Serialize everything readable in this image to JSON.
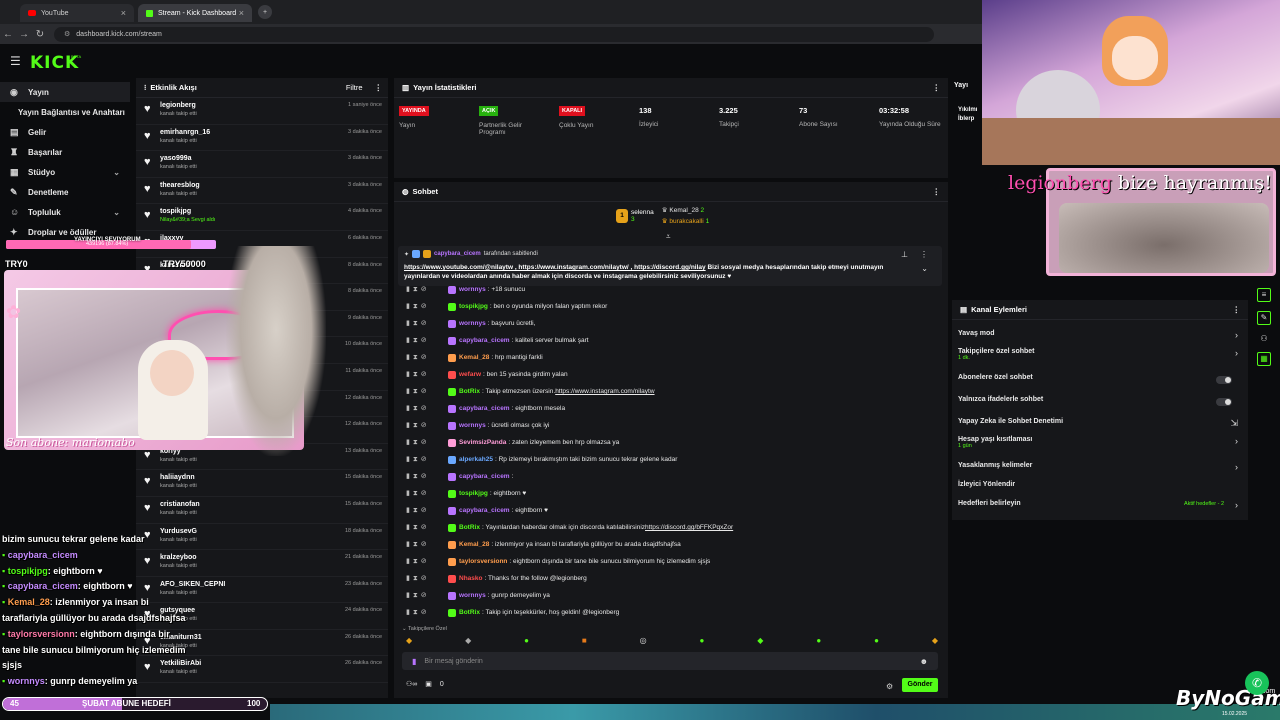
{
  "browser": {
    "tabs": [
      {
        "label": "YouTube"
      },
      {
        "label": "Stream - Kick Dashboard"
      }
    ],
    "url": "dashboard.kick.com/stream"
  },
  "kick": {
    "logo": "KICK",
    "logo_sup": "BETA"
  },
  "sidebar": {
    "items": [
      {
        "label": "Yayın",
        "icon": "broadcast-icon"
      },
      {
        "label": "Yayın Bağlantısı ve Anahtarı",
        "icon": ""
      },
      {
        "label": "Gelir",
        "icon": "wallet-icon"
      },
      {
        "label": "Başarılar",
        "icon": "trophy-icon"
      },
      {
        "label": "Stüdyo",
        "icon": "studio-icon"
      },
      {
        "label": "Denetleme",
        "icon": "wrench-icon"
      },
      {
        "label": "Topluluk",
        "icon": "community-icon"
      },
      {
        "label": "Droplar ve ödüller",
        "icon": "gift-icon"
      }
    ]
  },
  "activity": {
    "title": "Etkinlik Akışı",
    "filter": "Filtre",
    "items": [
      {
        "name": "legionberg",
        "sub": "kanalı takip etti",
        "time": "1 saniye önce"
      },
      {
        "name": "emirhanrgn_16",
        "sub": "kanalı takip etti",
        "time": "3 dakika önce"
      },
      {
        "name": "yaso999a",
        "sub": "kanalı takip etti",
        "time": "3 dakika önce"
      },
      {
        "name": "thearesblog",
        "sub": "kanalı takip etti",
        "time": "3 dakika önce"
      },
      {
        "name": "tospikjpg",
        "sub": "Nilay&#39;a Sevgi aldı",
        "time": "4 dakika önce"
      },
      {
        "name": "ilaxxyy",
        "sub": "",
        "time": "6 dakika önce"
      },
      {
        "name": "kakashisi",
        "sub": "",
        "time": "8 dakika önce"
      },
      {
        "name": "",
        "sub": "",
        "time": "8 dakika önce"
      },
      {
        "name": "",
        "sub": "",
        "time": "9 dakika önce"
      },
      {
        "name": "",
        "sub": "",
        "time": "10 dakika önce"
      },
      {
        "name": "",
        "sub": "",
        "time": "11 dakika önce"
      },
      {
        "name": "",
        "sub": "",
        "time": "12 dakika önce"
      },
      {
        "name": "",
        "sub": "",
        "time": "12 dakika önce"
      },
      {
        "name": "korlyy",
        "sub": "kanalı takip etti",
        "time": "13 dakika önce"
      },
      {
        "name": "haliiaydnn",
        "sub": "kanalı takip etti",
        "time": "15 dakika önce"
      },
      {
        "name": "cristianofan",
        "sub": "kanalı takip etti",
        "time": "15 dakika önce"
      },
      {
        "name": "YurdusevG",
        "sub": "kanalı takip etti",
        "time": "18 dakika önce"
      },
      {
        "name": "kralzeyboo",
        "sub": "kanalı takip etti",
        "time": "21 dakika önce"
      },
      {
        "name": "AFO_SIKEN_CEPNI",
        "sub": "kanalı takip etti",
        "time": "23 dakika önce"
      },
      {
        "name": "gutsyquee",
        "sub": "kanalı takip etti",
        "time": "24 dakika önce"
      },
      {
        "name": "emaniturn31",
        "sub": "kanalı takip etti",
        "time": "26 dakika önce"
      },
      {
        "name": "YetkiliBirAbi",
        "sub": "kanalı takip etti",
        "time": "26 dakika önce"
      }
    ]
  },
  "stats": {
    "title": "Yayın İstatistikleri",
    "items": [
      {
        "badge": "YAYINDA",
        "badge_color": "#e0101e",
        "label": "Yayın"
      },
      {
        "badge": "AÇIK",
        "badge_color": "#27b10e",
        "label": "Partnerlik Gelir Programı"
      },
      {
        "badge": "KAPALI",
        "badge_color": "#e0101e",
        "label": "Çoklu Yayın"
      },
      {
        "value": "138",
        "label": "İzleyici"
      },
      {
        "value": "3.225",
        "label": "Takipçi"
      },
      {
        "value": "73",
        "label": "Abone Sayısı"
      },
      {
        "value": "03:32:58",
        "label": "Yayında Olduğu Süre"
      }
    ]
  },
  "chat": {
    "title": "Sohbet",
    "top_gifters": [
      {
        "rank": "1",
        "name": "selenna",
        "count": "3"
      },
      {
        "name": "Kemal_28",
        "count": "2"
      },
      {
        "name": "burakcakalli",
        "count": "1"
      }
    ],
    "pinned_by": "capybara_cicem",
    "pinned_suffix": "tarafından sabitlendi",
    "pinned_text_links": "https://www.youtube.com/@nilaytw , https://www.instagram.com/nilaytw/ , https://discord.gg/nilay",
    "pinned_text": " Bizi sosyal medya hesaplarından takip etmeyi unutmayın yayınlardan ve videolardan anında haber almak için discorda ve instagrama gelebilirsiniz seviliyorsunuz ♥",
    "messages": [
      {
        "user": "wornnys",
        "color": "#b874ff",
        "text": ": +18 sunucu"
      },
      {
        "user": "tospikjpg",
        "color": "#53fc18",
        "text": ": ben o oyunda milyon falan yaptım rekor"
      },
      {
        "user": "wornnys",
        "color": "#b874ff",
        "text": ": başvuru ücretli,"
      },
      {
        "user": "capybara_cicem",
        "color": "#b874ff",
        "text": ": kaliteli server bulmak şart"
      },
      {
        "user": "Kemal_28",
        "color": "#ff9d4d",
        "text": ": hrp mantigi farkli"
      },
      {
        "user": "wefarw",
        "color": "#ff4d4d",
        "text": ": ben 15 yasinda girdim yalan"
      },
      {
        "user": "BotRix",
        "color": "#53fc18",
        "text": ": Takip etmezsen üzersin. ",
        "link": "https://www.instagram.com/nilaytw"
      },
      {
        "user": "capybara_cicem",
        "color": "#b874ff",
        "text": ": eightborn mesela"
      },
      {
        "user": "wornnys",
        "color": "#b874ff",
        "text": ": ücretli olması çok iyi"
      },
      {
        "user": "SevimsizPanda",
        "color": "#ff9dd8",
        "text": ": zaten izleyemem ben hrp olmazsa ya"
      },
      {
        "user": "alperkah25",
        "color": "#6aa8ff",
        "text": ": Rp izlemeyi bırakmıştım taki bizim sunucu tekrar gelene kadar"
      },
      {
        "user": "capybara_cicem",
        "color": "#b874ff",
        "text": ": "
      },
      {
        "user": "tospikjpg",
        "color": "#53fc18",
        "text": ": eightborn ♥"
      },
      {
        "user": "capybara_cicem",
        "color": "#b874ff",
        "text": ": eightborn ♥"
      },
      {
        "user": "BotRix",
        "color": "#53fc18",
        "text": ": Yayınlardan haberdar olmak için discorda katılabilirsiniz ",
        "link": "https://discord.gg/bFFKPqxZor"
      },
      {
        "user": "Kemal_28",
        "color": "#ff9d4d",
        "text": ": izlenmiyor ya insan bi taraflariyla güllüyor bu arada dsajdfshajfsa"
      },
      {
        "user": "taylorsversionn",
        "color": "#ff9d4d",
        "text": ": eightborn dışında bir tane bile sunucu bilmiyorum hiç izlemedim sjsjs"
      },
      {
        "user": "Nhasko",
        "color": "#ff4d4d",
        "text": ": Thanks for the follow @legionberg"
      },
      {
        "user": "wornnys",
        "color": "#b874ff",
        "text": ": gunrp demeyelim ya"
      },
      {
        "user": "BotRix",
        "color": "#53fc18",
        "text": ": Takip için teşekkürler, hoş geldin! @legionberg"
      }
    ],
    "followers_only": "Takipçilere Özel",
    "input_placeholder": "Bir mesaj gönderin",
    "count": "0",
    "send": "Gönder"
  },
  "channel_actions": {
    "title": "Kanal Eylemleri",
    "items": [
      {
        "label": "Yavaş mod"
      },
      {
        "label": "Takipçilere özel sohbet",
        "sub": "1 dk."
      },
      {
        "label": "Abonelere özel sohbet"
      },
      {
        "label": "Yalnızca ifadelerle sohbet"
      },
      {
        "label": "Yapay Zeka ile Sohbet Denetimi"
      },
      {
        "label": "Hesap yaşı kısıtlaması",
        "sub": "1 gün"
      },
      {
        "label": "Yasaklanmış kelimeler"
      },
      {
        "label": "İzleyici Yönlendir"
      },
      {
        "label": "Hedefleri belirleyin",
        "extra": "Aktif hedefler - 2"
      }
    ]
  },
  "overlay": {
    "raid_title": "YAYINCIYI SEVIYORUM",
    "raid_progress": "439196 (87.84%)",
    "try0": "TRY0",
    "try_goal": "TRY50000",
    "last_sub": "Son abone: mariomabo",
    "follow_alert": "legionberg",
    "follow_alert_text": " bize hayranmış!",
    "sub_goal": "ŞUBAT ABUNE HEDEFİ",
    "sub_goal_current": "45",
    "sub_goal_target": "100",
    "sub_goal_fraction": 0.45,
    "watermark": "ByNoGame",
    "watermark_suffix": ".com",
    "watermark_date": "15.02.2025",
    "topcam_partial_title": "Yayı",
    "topcam_partial_text": "Yıkılmı İblerp",
    "chat_lines": [
      {
        "text": "bizim sunucu tekrar gelene kadar"
      },
      {
        "user": "capybara_cicem",
        "color": "#c58cff",
        "text": ""
      },
      {
        "user": "tospikjpg",
        "color": "#53fc18",
        "text": ": eightborn ♥"
      },
      {
        "user": "capybara_cicem",
        "color": "#c58cff",
        "text": ": eightborn ♥"
      },
      {
        "user": "Kemal_28",
        "color": "#ff9d4d",
        "text": ": izlenmiyor ya insan bi"
      },
      {
        "text": "taraflariyla güllüyor bu arada dsajdfshajfsa"
      },
      {
        "user": "taylorsversionn",
        "color": "#ff7aa8",
        "text": ": eightborn dışında bir"
      },
      {
        "text": "tane bile sunucu bilmiyorum hiç izlemedim"
      },
      {
        "text": "sjsjs"
      },
      {
        "user": "wornnys",
        "color": "#c58cff",
        "text": ": gunrp demeyelim ya"
      }
    ]
  }
}
